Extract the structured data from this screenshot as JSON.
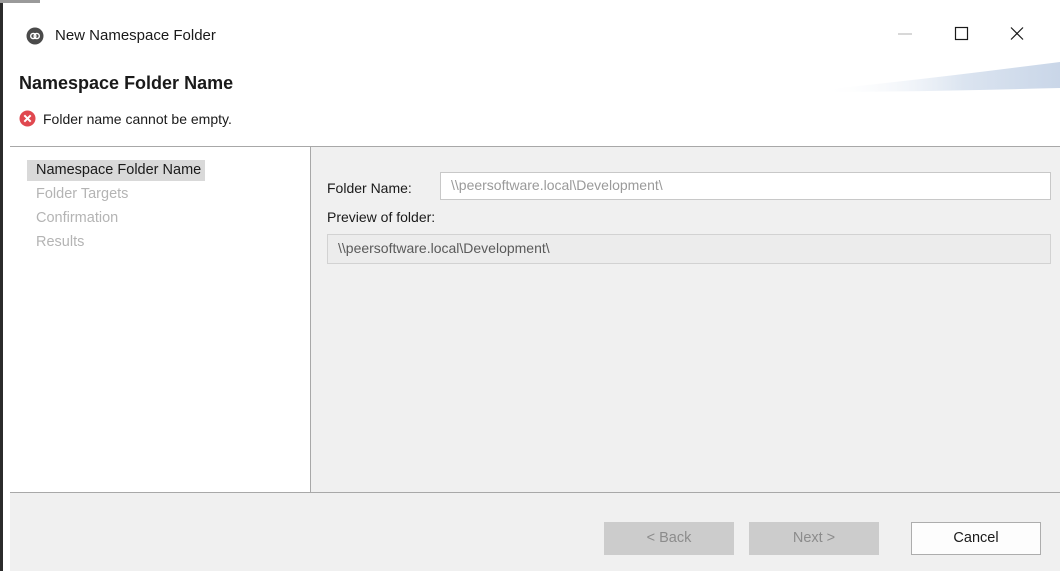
{
  "window": {
    "title": "New Namespace Folder",
    "controls": {
      "minimize_icon": "minimize-icon",
      "maximize_icon": "maximize-icon",
      "close_icon": "close-icon"
    }
  },
  "header": {
    "title": "Namespace Folder Name",
    "message": "Folder name cannot be empty.",
    "message_icon": "error-icon",
    "error_color": "#e0484f"
  },
  "nav": {
    "items": [
      {
        "label": "Namespace Folder Name",
        "state": "active"
      },
      {
        "label": "Folder Targets",
        "state": "disabled"
      },
      {
        "label": "Confirmation",
        "state": "disabled"
      },
      {
        "label": "Results",
        "state": "disabled"
      }
    ]
  },
  "form": {
    "folder_name_label": "Folder Name:",
    "folder_name_placeholder": "\\\\peersoftware.local\\Development\\",
    "folder_name_value": "",
    "preview_label": "Preview of folder:",
    "preview_value": "\\\\peersoftware.local\\Development\\"
  },
  "buttons": {
    "back": "< Back",
    "next": "Next >",
    "cancel": "Cancel"
  }
}
